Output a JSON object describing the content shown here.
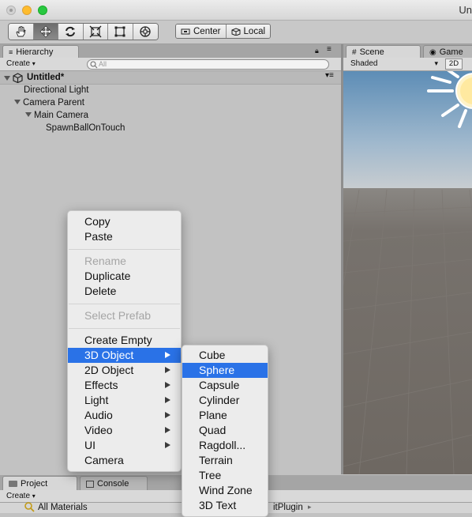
{
  "window": {
    "title": "Un"
  },
  "toolbar": {
    "tools": [
      {
        "icon": "hand-tool-icon"
      },
      {
        "icon": "move-tool-icon"
      },
      {
        "icon": "rotate-tool-icon"
      },
      {
        "icon": "scale-tool-icon"
      },
      {
        "icon": "rect-tool-icon"
      },
      {
        "icon": "transform-tool-icon"
      }
    ],
    "pivot_label": "Center",
    "space_label": "Local"
  },
  "hierarchy": {
    "tab_label": "Hierarchy",
    "create_label": "Create",
    "search_placeholder": "All",
    "scene_name": "Untitled*",
    "items": [
      {
        "label": "Directional Light"
      },
      {
        "label": "Camera Parent"
      },
      {
        "label": "Main Camera"
      },
      {
        "label": "SpawnBallOnTouch"
      }
    ]
  },
  "scene": {
    "tab_scene": "Scene",
    "tab_game": "Game",
    "shading_mode": "Shaded",
    "mode_2d": "2D"
  },
  "project": {
    "tab_project": "Project",
    "tab_console": "Console",
    "create_label": "Create",
    "first_item": "All Materials",
    "breadcrumb_fragment": "itPlugin"
  },
  "context_menu": {
    "items": [
      {
        "label": "Copy",
        "enabled": true
      },
      {
        "label": "Paste",
        "enabled": true
      },
      {
        "label": "Rename",
        "enabled": false
      },
      {
        "label": "Duplicate",
        "enabled": true
      },
      {
        "label": "Delete",
        "enabled": true
      },
      {
        "label": "Select Prefab",
        "enabled": false
      },
      {
        "label": "Create Empty",
        "enabled": true
      },
      {
        "label": "3D Object",
        "enabled": true,
        "submenu": true,
        "highlighted": true
      },
      {
        "label": "2D Object",
        "enabled": true,
        "submenu": true
      },
      {
        "label": "Effects",
        "enabled": true,
        "submenu": true
      },
      {
        "label": "Light",
        "enabled": true,
        "submenu": true
      },
      {
        "label": "Audio",
        "enabled": true,
        "submenu": true
      },
      {
        "label": "Video",
        "enabled": true,
        "submenu": true
      },
      {
        "label": "UI",
        "enabled": true,
        "submenu": true
      },
      {
        "label": "Camera",
        "enabled": true
      }
    ]
  },
  "submenu_3d": {
    "items": [
      {
        "label": "Cube"
      },
      {
        "label": "Sphere",
        "highlighted": true
      },
      {
        "label": "Capsule"
      },
      {
        "label": "Cylinder"
      },
      {
        "label": "Plane"
      },
      {
        "label": "Quad"
      },
      {
        "label": "Ragdoll..."
      },
      {
        "label": "Terrain"
      },
      {
        "label": "Tree"
      },
      {
        "label": "Wind Zone"
      },
      {
        "label": "3D Text"
      }
    ]
  },
  "colors": {
    "highlight": "#2a72e7",
    "panel_bg": "#c2c2c2",
    "sky_top": "#5d8db6",
    "ground": "#6e6862"
  }
}
